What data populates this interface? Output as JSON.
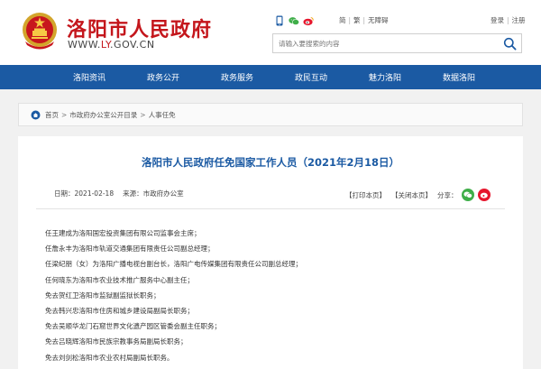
{
  "header": {
    "site_title": "洛阳市人民政府",
    "domain_www": "WWW.",
    "domain_ly": "LY",
    "domain_rest": ".GOV.CN",
    "tool_links": [
      "简",
      "繁",
      "无障碍"
    ],
    "login": "登录",
    "register": "注册",
    "search_placeholder": "请输入要搜索的内容"
  },
  "nav": {
    "items": [
      "洛阳资讯",
      "政务公开",
      "政务服务",
      "政民互动",
      "魅力洛阳",
      "数据洛阳"
    ]
  },
  "breadcrumb": {
    "items": [
      "首页",
      "市政府办公室公开目录",
      "人事任免"
    ]
  },
  "article": {
    "title": "洛阳市人民政府任免国家工作人员（2021年2月18日）",
    "date_label": "日期：2021-02-18",
    "source_label": "来源：市政府办公室",
    "print_label": "【打印本页】",
    "close_label": "【关闭本页】",
    "share_label": "分享：",
    "paragraphs": [
      "任王建成为洛阳国宏投资集团有限公司监事会主席；",
      "任詹永丰为洛阳市轨道交通集团有限责任公司副总经理；",
      "任梁纪朋（女）为洛阳广播电视台副台长，洛阳广电传媒集团有限责任公司副总经理；",
      "任何晓东为洛阳市农业技术推广服务中心副主任；",
      "免去贺红卫洛阳市监狱副监狱长职务；",
      "免去韩兴忠洛阳市住房和城乡建设局副局长职务；",
      "免去吴顺华龙门石窟世界文化遗产园区管委会副主任职务；",
      "免去吕晓辉洛阳市民族宗教事务局副局长职务；",
      "免去刘剑松洛阳市农业农村局副局长职务。"
    ]
  },
  "colors": {
    "brand_red": "#c4161c",
    "nav_blue": "#1b5aa3",
    "wechat_green": "#3fae49",
    "weibo_red": "#e6162d"
  },
  "icons": [
    "emblem-icon",
    "mobile-icon",
    "wechat-icon",
    "weibo-icon",
    "search-icon",
    "home-icon"
  ]
}
